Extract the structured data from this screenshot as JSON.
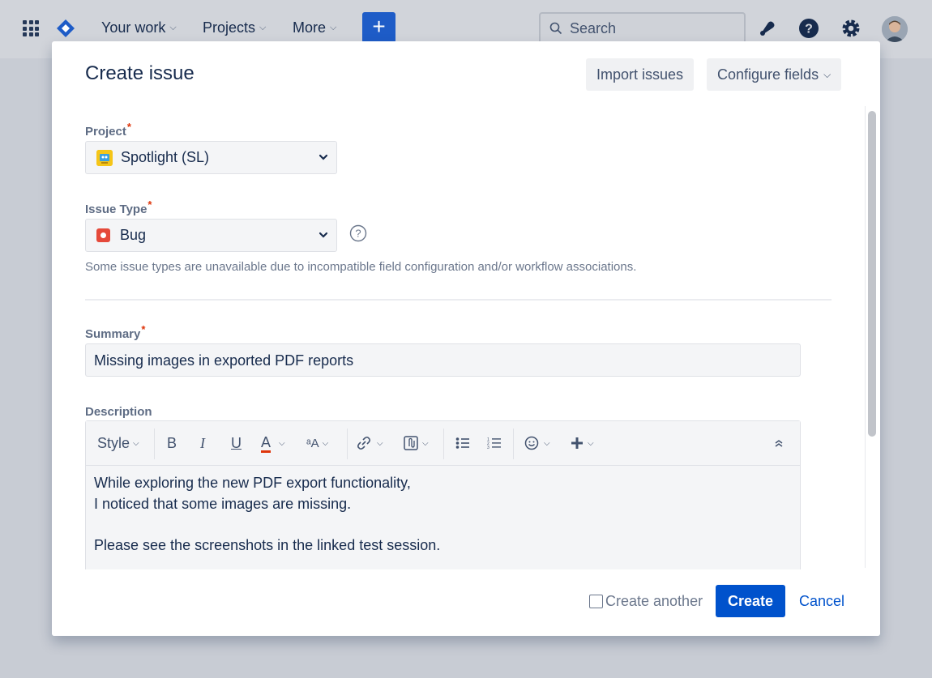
{
  "topnav": {
    "your_work": "Your work",
    "projects": "Projects",
    "more": "More",
    "create_icon": "plus-icon",
    "search_placeholder": "Search",
    "icons": [
      "apps-grid-icon",
      "jira-logo-icon",
      "notifications-icon",
      "help-icon",
      "settings-icon",
      "avatar"
    ]
  },
  "modal": {
    "title": "Create issue",
    "import_issues": "Import issues",
    "configure_fields": "Configure fields",
    "project": {
      "label": "Project",
      "required_mark": "*",
      "value": "Spotlight (SL)"
    },
    "issue_type": {
      "label": "Issue Type",
      "required_mark": "*",
      "value": "Bug",
      "hint": "Some issue types are unavailable due to incompatible field configuration and/or workflow associations."
    },
    "summary": {
      "label": "Summary",
      "required_mark": "*",
      "value": "Missing images in exported PDF reports"
    },
    "description": {
      "label": "Description",
      "toolbar": {
        "style": "Style",
        "bold": "B",
        "italic": "I",
        "underline": "U",
        "text_color": "A",
        "more_formatting": "ᵃA"
      },
      "lines": [
        "While exploring the new PDF export functionality,",
        "I noticed that some images are missing.",
        "",
        "Please see the screenshots in the linked test session."
      ]
    },
    "footer": {
      "create_another": "Create another",
      "create": "Create",
      "cancel": "Cancel"
    }
  },
  "colors": {
    "primary": "#0052cc",
    "required": "#de350b",
    "text": "#172b4d",
    "project_icon": "#f5c518",
    "bug_icon": "#e5493a"
  }
}
